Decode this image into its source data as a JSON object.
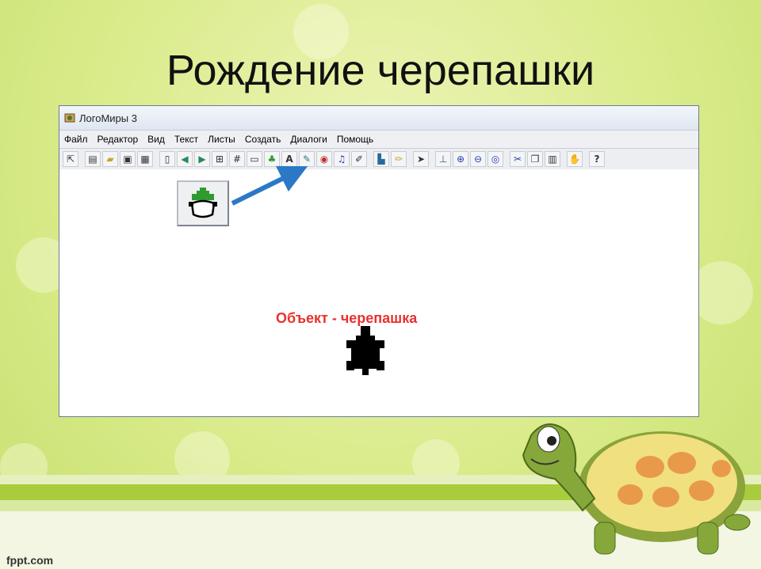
{
  "slide": {
    "title": "Рождение черепашки",
    "footer": "fppt.com"
  },
  "window": {
    "title": "ЛогоМиры 3",
    "menu": [
      "Файл",
      "Редактор",
      "Вид",
      "Текст",
      "Листы",
      "Создать",
      "Диалоги",
      "Помощь"
    ],
    "toolbar_icons": [
      "pointer-tool",
      "page",
      "open-folder",
      "save",
      "print",
      "new-page",
      "back-arrow",
      "forward-arrow",
      "grid-small",
      "grid",
      "rectangle",
      "new-turtle",
      "text-box",
      "pen",
      "eye-record",
      "music-note",
      "brush",
      "stamp",
      "paint",
      "select-arrow",
      "stamp2",
      "zoom-in",
      "zoom-out",
      "eye",
      "scissors",
      "copy",
      "paste",
      "stop",
      "help"
    ],
    "caption": "Объект - черепашка"
  },
  "colors": {
    "caption": "#e8312f",
    "arrow": "#2b79c6",
    "turtle_green": "#2f9b2f"
  }
}
